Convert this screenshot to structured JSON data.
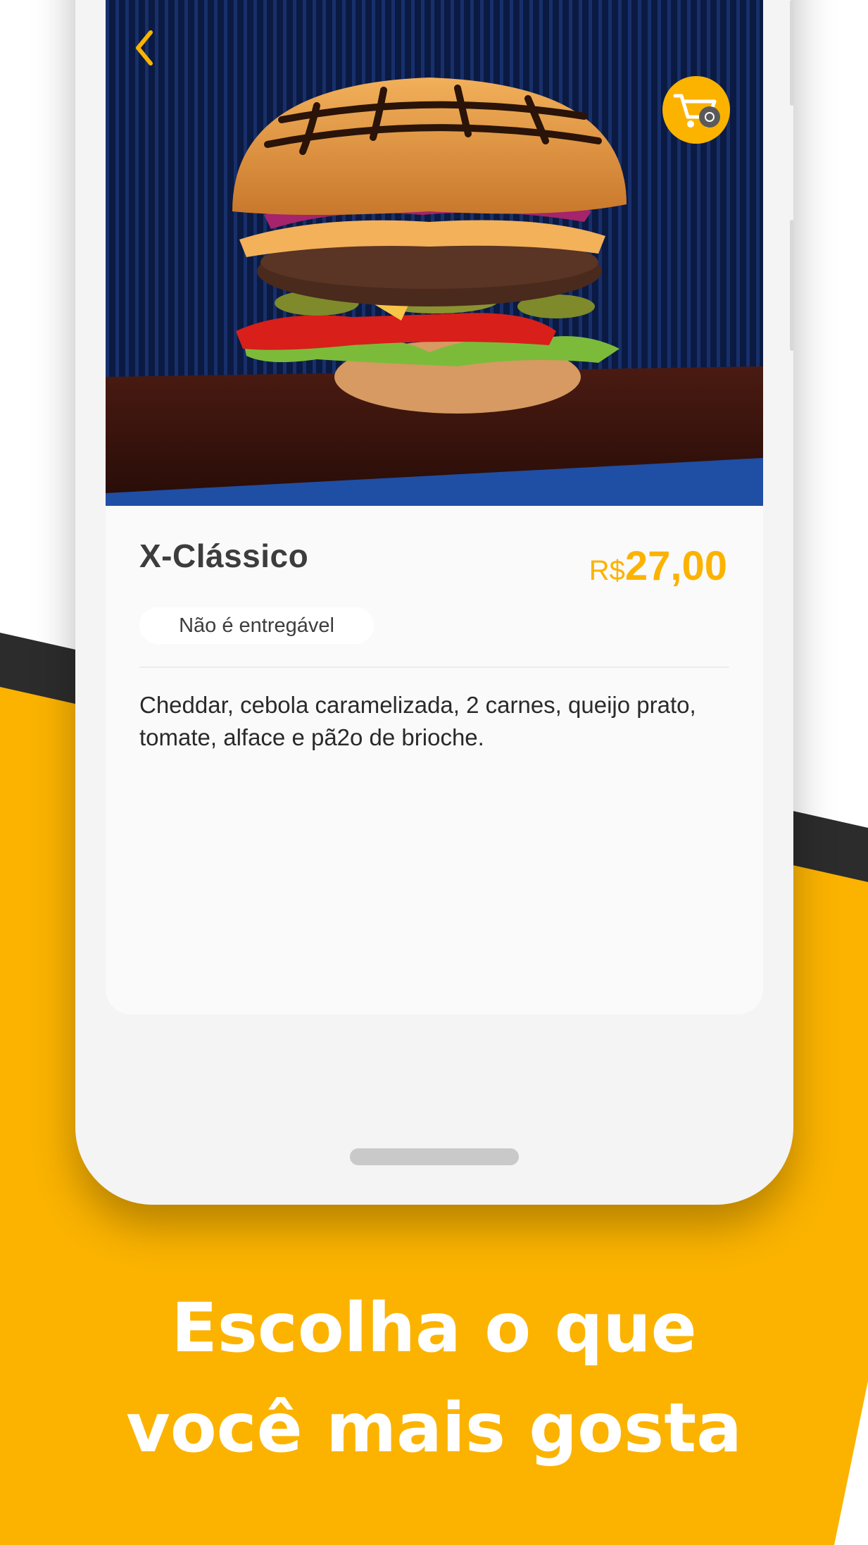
{
  "colors": {
    "accent": "#fbb300",
    "dark_band": "#2c2c2c",
    "phone_body": "#f4f4f4",
    "screen_bg": "#fafafa",
    "title_text": "#3d3d3d",
    "tagline_text": "#ffffff"
  },
  "icons": {
    "back": "chevron-left-icon",
    "cart": "shopping-cart-icon"
  },
  "product": {
    "name": "X-Clássico",
    "price_currency": "R$",
    "price_amount": "27,00",
    "badge": "Não é entregável",
    "description": "Cheddar, cebola caramelizada, 2 carnes, queijo prato, tomate, alface e pã2o de brioche."
  },
  "tagline": {
    "line1": "Escolha o que",
    "line2": "você mais gosta"
  }
}
